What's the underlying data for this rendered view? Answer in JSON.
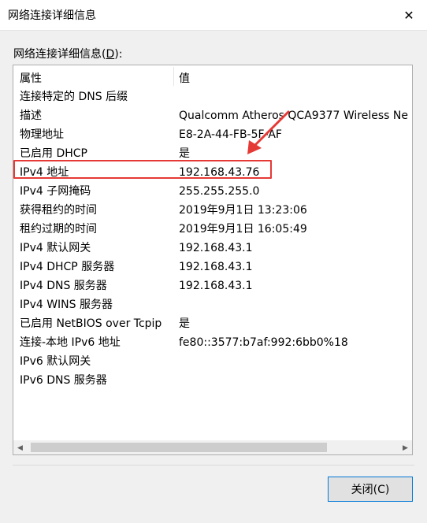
{
  "window": {
    "title": "网络连接详细信息",
    "close_glyph": "✕"
  },
  "group": {
    "label": "网络连接详细信息(",
    "accel": "D",
    "label_end": "):"
  },
  "table": {
    "columns": [
      "属性",
      "值"
    ],
    "rows": [
      [
        "连接特定的 DNS 后缀",
        ""
      ],
      [
        "描述",
        "Qualcomm Atheros QCA9377 Wireless Ne"
      ],
      [
        "物理地址",
        "E8-2A-44-FB-5F-AF"
      ],
      [
        "已启用 DHCP",
        "是"
      ],
      [
        "IPv4 地址",
        "192.168.43.76"
      ],
      [
        "IPv4 子网掩码",
        "255.255.255.0"
      ],
      [
        "获得租约的时间",
        "2019年9月1日 13:23:06"
      ],
      [
        "租约过期的时间",
        "2019年9月1日 16:05:49"
      ],
      [
        "IPv4 默认网关",
        "192.168.43.1"
      ],
      [
        "IPv4 DHCP 服务器",
        "192.168.43.1"
      ],
      [
        "IPv4 DNS 服务器",
        "192.168.43.1"
      ],
      [
        "IPv4 WINS 服务器",
        ""
      ],
      [
        "已启用 NetBIOS over Tcpip",
        "是"
      ],
      [
        "连接-本地 IPv6 地址",
        "fe80::3577:b7af:992:6bb0%18"
      ],
      [
        "IPv6 默认网关",
        ""
      ],
      [
        "IPv6 DNS 服务器",
        ""
      ]
    ],
    "highlight_color": "#e53935",
    "highlight_row": "IPv4 地址"
  },
  "scrollbar": {
    "left_arrow": "◀",
    "right_arrow": "▶"
  },
  "buttons": {
    "close_label": "关闭(C)"
  },
  "colors": {
    "accent": "#0078d7",
    "annotation": "#e53935"
  }
}
